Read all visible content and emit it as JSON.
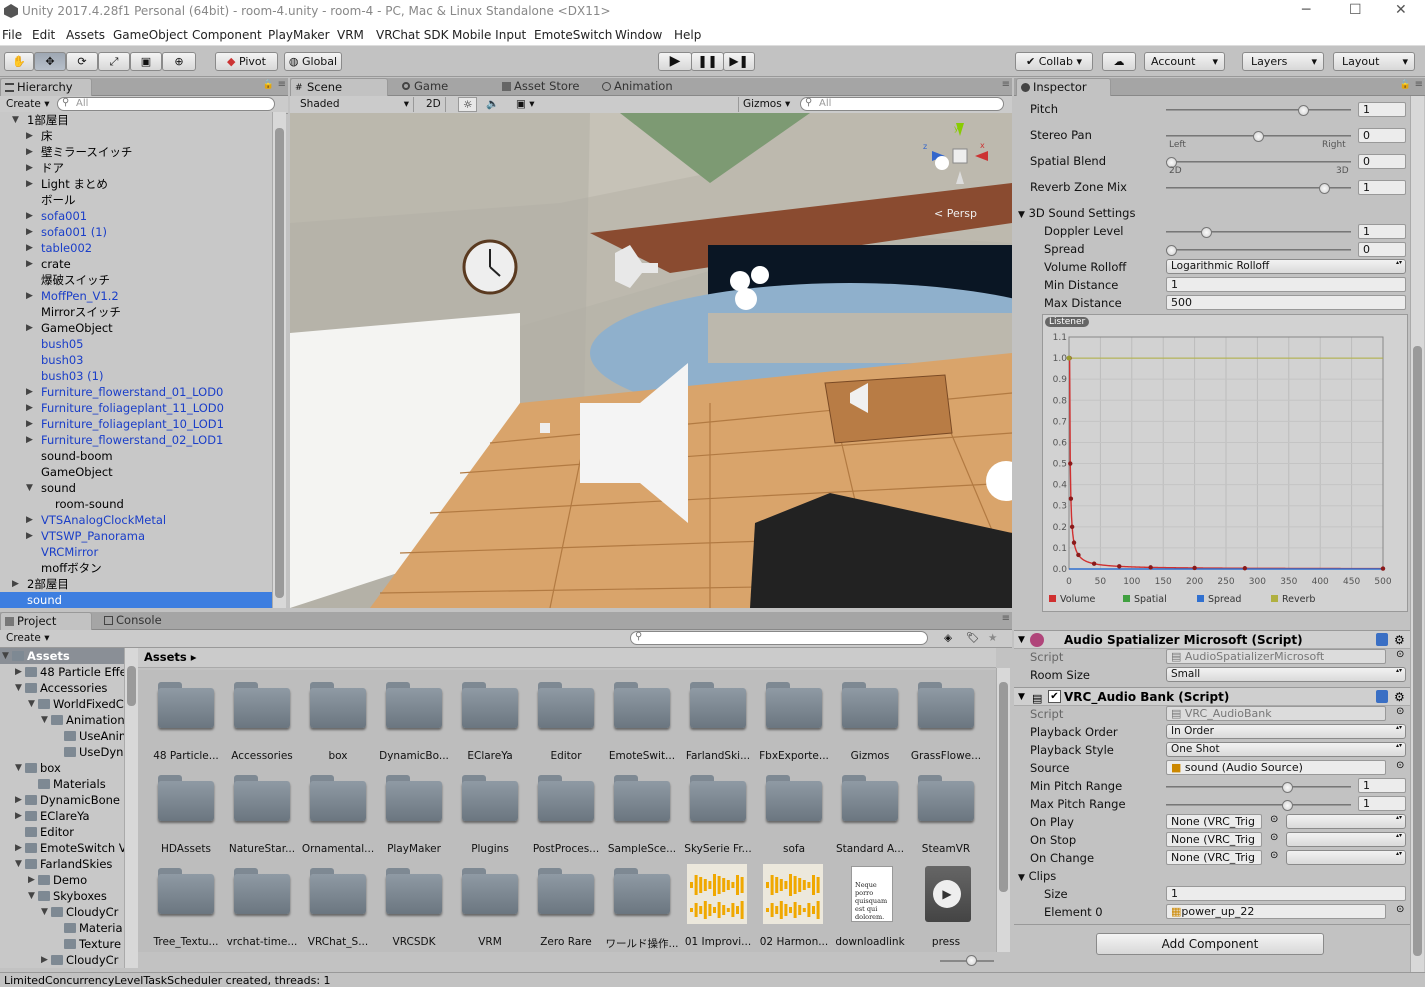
{
  "window": {
    "title": "Unity 2017.4.28f1 Personal (64bit) - room-4.unity - room-4 - PC, Mac & Linux Standalone <DX11>"
  },
  "menu": [
    "File",
    "Edit",
    "Assets",
    "GameObject",
    "Component",
    "PlayMaker",
    "VRM",
    "VRChat SDK",
    "Mobile Input",
    "EmoteSwitch",
    "Window",
    "Help"
  ],
  "toolbar": {
    "pivot": "Pivot",
    "global": "Global",
    "collab": "Collab",
    "account": "Account",
    "layers": "Layers",
    "layout": "Layout"
  },
  "hierarchy": {
    "tab": "Hierarchy",
    "create": "Create",
    "search_placeholder": "All",
    "items": [
      {
        "label": "1部屋目",
        "depth": 0,
        "arrow": "open",
        "style": "bold"
      },
      {
        "label": "床",
        "depth": 1,
        "arrow": "closed",
        "style": "black"
      },
      {
        "label": "壁ミラースイッチ",
        "depth": 1,
        "arrow": "closed",
        "style": "black"
      },
      {
        "label": "ドア",
        "depth": 1,
        "arrow": "closed",
        "style": "black"
      },
      {
        "label": "Light まとめ",
        "depth": 1,
        "arrow": "closed",
        "style": "black"
      },
      {
        "label": "ボール",
        "depth": 1,
        "arrow": "none",
        "style": "black"
      },
      {
        "label": "sofa001",
        "depth": 1,
        "arrow": "closed",
        "style": "blue"
      },
      {
        "label": "sofa001 (1)",
        "depth": 1,
        "arrow": "closed",
        "style": "blue"
      },
      {
        "label": "table002",
        "depth": 1,
        "arrow": "closed",
        "style": "blue"
      },
      {
        "label": "crate",
        "depth": 1,
        "arrow": "closed",
        "style": "black"
      },
      {
        "label": "爆破スイッチ",
        "depth": 1,
        "arrow": "none",
        "style": "black"
      },
      {
        "label": "MoffPen_V1.2",
        "depth": 1,
        "arrow": "closed",
        "style": "blue"
      },
      {
        "label": "Mirrorスイッチ",
        "depth": 1,
        "arrow": "none",
        "style": "black"
      },
      {
        "label": "GameObject",
        "depth": 1,
        "arrow": "closed",
        "style": "black"
      },
      {
        "label": "bush05",
        "depth": 1,
        "arrow": "none",
        "style": "blue"
      },
      {
        "label": "bush03",
        "depth": 1,
        "arrow": "none",
        "style": "blue"
      },
      {
        "label": "bush03 (1)",
        "depth": 1,
        "arrow": "none",
        "style": "blue"
      },
      {
        "label": "Furniture_flowerstand_01_LOD0",
        "depth": 1,
        "arrow": "closed",
        "style": "blue"
      },
      {
        "label": "Furniture_foliageplant_11_LOD0",
        "depth": 1,
        "arrow": "closed",
        "style": "blue"
      },
      {
        "label": "Furniture_foliageplant_10_LOD1",
        "depth": 1,
        "arrow": "closed",
        "style": "blue"
      },
      {
        "label": "Furniture_flowerstand_02_LOD1",
        "depth": 1,
        "arrow": "closed",
        "style": "blue"
      },
      {
        "label": "sound-boom",
        "depth": 1,
        "arrow": "none",
        "style": "black"
      },
      {
        "label": "GameObject",
        "depth": 1,
        "arrow": "none",
        "style": "black"
      },
      {
        "label": "sound",
        "depth": 1,
        "arrow": "open",
        "style": "black"
      },
      {
        "label": "room-sound",
        "depth": 2,
        "arrow": "none",
        "style": "black"
      },
      {
        "label": "VTSAnalogClockMetal",
        "depth": 1,
        "arrow": "closed",
        "style": "blue"
      },
      {
        "label": "VTSWP_Panorama",
        "depth": 1,
        "arrow": "closed",
        "style": "blue"
      },
      {
        "label": "VRCMirror",
        "depth": 1,
        "arrow": "none",
        "style": "blue"
      },
      {
        "label": "moffボタン",
        "depth": 1,
        "arrow": "none",
        "style": "black"
      },
      {
        "label": "2部屋目",
        "depth": 0,
        "arrow": "closed",
        "style": "black"
      },
      {
        "label": "sound",
        "depth": 0,
        "arrow": "none",
        "style": "selected"
      }
    ]
  },
  "scene": {
    "tabs": [
      "Scene",
      "Game",
      "Asset Store",
      "Animation"
    ],
    "shading": "Shaded",
    "mode2d": "2D",
    "gizmos": "Gizmos",
    "search_placeholder": "All",
    "persp": "< Persp"
  },
  "project": {
    "tabs": [
      "Project",
      "Console"
    ],
    "create": "Create",
    "breadcrumb": "Assets",
    "tree": [
      {
        "label": "Assets",
        "depth": 0,
        "arrow": "open",
        "sel": true
      },
      {
        "label": "48 Particle Effects",
        "depth": 1,
        "arrow": "closed"
      },
      {
        "label": "Accessories",
        "depth": 1,
        "arrow": "open"
      },
      {
        "label": "WorldFixedCam",
        "depth": 2,
        "arrow": "open"
      },
      {
        "label": "Animations",
        "depth": 3,
        "arrow": "open"
      },
      {
        "label": "UseAnim",
        "depth": 4,
        "arrow": "none"
      },
      {
        "label": "UseDyn",
        "depth": 4,
        "arrow": "none"
      },
      {
        "label": "box",
        "depth": 1,
        "arrow": "open"
      },
      {
        "label": "Materials",
        "depth": 2,
        "arrow": "none"
      },
      {
        "label": "DynamicBone",
        "depth": 1,
        "arrow": "closed"
      },
      {
        "label": "EClareYa",
        "depth": 1,
        "arrow": "closed"
      },
      {
        "label": "Editor",
        "depth": 1,
        "arrow": "none"
      },
      {
        "label": "EmoteSwitch V",
        "depth": 1,
        "arrow": "closed"
      },
      {
        "label": "FarlandSkies",
        "depth": 1,
        "arrow": "open"
      },
      {
        "label": "Demo",
        "depth": 2,
        "arrow": "closed"
      },
      {
        "label": "Skyboxes",
        "depth": 2,
        "arrow": "open"
      },
      {
        "label": "CloudyCr",
        "depth": 3,
        "arrow": "open"
      },
      {
        "label": "Materia",
        "depth": 4,
        "arrow": "none"
      },
      {
        "label": "Texture",
        "depth": 4,
        "arrow": "none"
      },
      {
        "label": "CloudyCr",
        "depth": 3,
        "arrow": "closed"
      }
    ],
    "assets": [
      [
        "48 Particle...",
        "Accessories",
        "box",
        "DynamicBo...",
        "EClareYa",
        "Editor",
        "EmoteSwit...",
        "FarlandSki...",
        "FbxExporte...",
        "Gizmos",
        "GrassFlowe..."
      ],
      [
        "HDAssets",
        "NatureStar...",
        "Ornamental...",
        "PlayMaker",
        "Plugins",
        "PostProces...",
        "SampleSce...",
        "SkySerie Fr...",
        "sofa",
        "Standard A...",
        "SteamVR"
      ],
      [
        "Tree_Textu...",
        "vrchat-time...",
        "VRChat_S...",
        "VRCSDK",
        "VRM",
        "Zero Rare",
        "ワールド操作...",
        "01 Improvi...",
        "02 Harmon...",
        "downloadlink",
        "press"
      ]
    ],
    "doc_text": "Neque porro quisquam est qui dolorem."
  },
  "inspector": {
    "tab": "Inspector",
    "pitch": {
      "label": "Pitch",
      "value": "1",
      "level": 0.76
    },
    "stereo_pan": {
      "label": "Stereo Pan",
      "value": "0",
      "level": 0.5,
      "left": "Left",
      "right": "Right"
    },
    "spatial_blend": {
      "label": "Spatial Blend",
      "value": "0",
      "level": 0.0,
      "l2d": "2D",
      "l3d": "3D"
    },
    "reverb": {
      "label": "Reverb Zone Mix",
      "value": "1",
      "level": 0.88
    },
    "sound3d": {
      "header": "3D Sound Settings",
      "doppler": {
        "label": "Doppler Level",
        "value": "1",
        "level": 0.2
      },
      "spread": {
        "label": "Spread",
        "value": "0",
        "level": 0.0
      },
      "rolloff": {
        "label": "Volume Rolloff",
        "value": "Logarithmic Rolloff"
      },
      "min": {
        "label": "Min Distance",
        "value": "1"
      },
      "max": {
        "label": "Max Distance",
        "value": "500"
      }
    },
    "graph": {
      "listener": "Listener",
      "y_ticks": [
        "1.1",
        "1.0",
        "0.9",
        "0.8",
        "0.7",
        "0.6",
        "0.5",
        "0.4",
        "0.3",
        "0.2",
        "0.1",
        "0.0"
      ],
      "x_ticks": [
        "0",
        "50",
        "100",
        "150",
        "200",
        "250",
        "300",
        "350",
        "400",
        "450",
        "500"
      ],
      "legend": [
        "Volume",
        "Spatial",
        "Spread",
        "Reverb"
      ],
      "legend_colors": [
        "#d03030",
        "#40a040",
        "#3070d0",
        "#b0b040"
      ]
    },
    "spatializer": {
      "title": "Audio Spatializer Microsoft (Script)",
      "script_label": "Script",
      "script_value": "AudioSpatializerMicrosoft",
      "room_label": "Room Size",
      "room_value": "Small"
    },
    "audiobank": {
      "title": "VRC_Audio Bank (Script)",
      "script_label": "Script",
      "script_value": "VRC_AudioBank",
      "order_label": "Playback Order",
      "order_value": "In Order",
      "style_label": "Playback Style",
      "style_value": "One Shot",
      "source_label": "Source",
      "source_value": "sound (Audio Source)",
      "minp_label": "Min Pitch Range",
      "minp_value": "1",
      "maxp_label": "Max Pitch Range",
      "maxp_value": "1",
      "onplay_label": "On Play",
      "onstop_label": "On Stop",
      "onchange_label": "On Change",
      "none_value": "None (VRC_Trig",
      "clips_label": "Clips",
      "size_label": "Size",
      "size_value": "1",
      "elem_label": "Element 0",
      "elem_value": "power_up_22"
    },
    "add_component": "Add Component"
  },
  "status": "LimitedConcurrencyLevelTaskScheduler created, threads: 1"
}
